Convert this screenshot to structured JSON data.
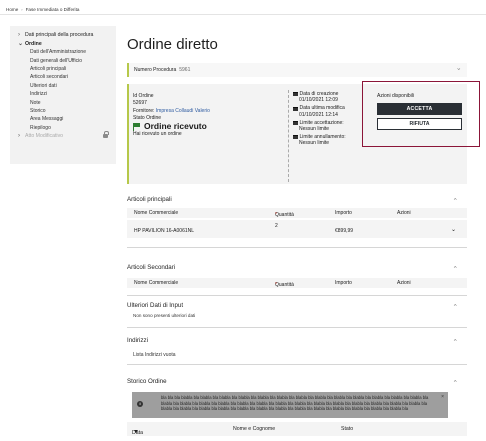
{
  "breadcrumb": {
    "home": "Home",
    "sep": "›",
    "current": "Fase Immediata o Differita"
  },
  "sidebar": {
    "items": [
      {
        "label": "Dati principali della procedura",
        "chev": "›"
      },
      {
        "label": "Ordine",
        "chev": "⌄"
      }
    ],
    "subitems": [
      "Dati dell'Amministrazione",
      "Dati generali dell'Ufficio",
      "Articoli principali",
      "Articoli secondari",
      "Ulteriori dati",
      "Indirizzi",
      "Note",
      "Storico",
      "Area Messaggi",
      "Riepilogo"
    ],
    "locked": {
      "label": "Atto Modificativo",
      "chev": "›"
    }
  },
  "page": {
    "title": "Ordine diretto"
  },
  "procedura": {
    "label": "Numero Procedura",
    "number": "5961",
    "chev": "›"
  },
  "ordine": {
    "id_label": "Id Ordine",
    "id_value": "52697",
    "fornitore_label": "Fornitore:",
    "fornitore_value": "Impresa Collaudi Valerio",
    "stato_label": "Stato Ordine",
    "stato_value": "Ordine ricevuto",
    "stato_desc": "Hai ricevuto un ordine",
    "creazione_label": "Data di creazione",
    "creazione_value": "01/10/2021 12:09",
    "modifica_label": "Data ultima modifica",
    "modifica_value": "01/10/2021 12:14",
    "limite_acc_label": "Limite accettazione:",
    "limite_acc_value": "Nessun limite",
    "limite_ann_label": "Limite annullamento:",
    "limite_ann_value": "Nessun limite"
  },
  "azioni": {
    "title": "Azioni disponibili",
    "accetta": "ACCETTA",
    "rifiuta": "RIFIUTA"
  },
  "articoli_principali": {
    "title": "Articoli principali",
    "cols": {
      "nome": "Nome Commerciale",
      "quantita": "Quantità",
      "importo": "Importo",
      "azioni": "Azioni"
    },
    "req": "*",
    "row": {
      "nome": "HP PAVILION 16-A0061NL",
      "quantita": "2",
      "importo": "€899,99"
    }
  },
  "articoli_secondari": {
    "title": "Articoli Secondari",
    "cols": {
      "nome": "Nome Commerciale",
      "quantita": "Quantità",
      "importo": "Importo",
      "azioni": "Azioni"
    },
    "req": "*"
  },
  "ulteriori": {
    "title": "Ulteriori Dati di Input",
    "empty": "Non sono presenti ulteriori dati"
  },
  "indirizzi": {
    "title": "Indirizzi",
    "empty": "Lista Indirizzi vuota"
  },
  "storico": {
    "title": "Storico Ordine",
    "message": "bla bla bla blabla bla blabla bla blabla bla blabla bla blabla bla blabla bla blabla bla blabla bla blabla bla blabla bla blabla bla blabla bla blabla bla blabla bla blabla bla blabla bla blabla bla blabla bla blabla bla blabla bla blabla bla blabla bla blabla bla blabla bla blabla bla blabla bla blabla bla blabla bla blabla bla blabla bla blabla bla blabla bla blabla bla blabla bla blabla bla blabla bla blabla bla blabla bla blabla bla blabla bla",
    "info_icon": "i",
    "close": "×",
    "cols": {
      "data": "Data",
      "nome": "Nome e Cognome",
      "stato": "Stato"
    }
  },
  "icons": {
    "expand": "›",
    "collapse": "›",
    "row_expand": "⌄"
  },
  "colors": {
    "accent": "#b6c84a",
    "highlight_frame": "#8b1538",
    "primary_button": "#2a2f35",
    "stato_green": "#2e7d32",
    "link": "#2d5aa0"
  }
}
